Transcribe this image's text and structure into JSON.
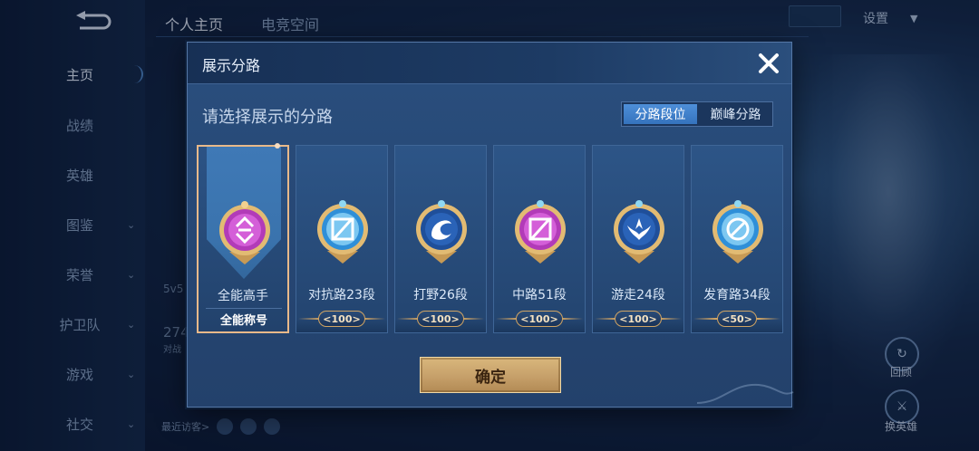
{
  "background": {
    "back_icon": "back-arrow-icon",
    "top_tabs": [
      "个人主页",
      "电竞空间"
    ],
    "settings_label": "设置",
    "sidebar_items": [
      {
        "label": "主页",
        "chevron": false,
        "active": true
      },
      {
        "label": "战绩",
        "chevron": false
      },
      {
        "label": "英雄",
        "chevron": false
      },
      {
        "label": "图鉴",
        "chevron": true
      },
      {
        "label": "荣誉",
        "chevron": true
      },
      {
        "label": "护卫队",
        "chevron": true
      },
      {
        "label": "游戏",
        "chevron": true
      },
      {
        "label": "社交",
        "chevron": true
      }
    ],
    "ghost_text": [
      "5v5",
      "274",
      "对战"
    ],
    "recent_visitors_label": "最近访客>",
    "right_button_1": "回顾",
    "right_button_2": "换英雄"
  },
  "dialog": {
    "title": "展示分路",
    "close_icon": "close-x-icon",
    "prompt": "请选择展示的分路",
    "toggle": {
      "options": [
        "分路段位",
        "巅峰分路"
      ],
      "selected": 0
    },
    "cards": [
      {
        "label": "全能高手",
        "sub": "全能称号",
        "badge": "omni-badge-icon",
        "selected": true,
        "color": "#b23bb8"
      },
      {
        "label": "对抗路23段",
        "score": "<100>",
        "badge": "clash-lane-badge-icon",
        "color": "#2f8fd8"
      },
      {
        "label": "打野26段",
        "score": "<100>",
        "badge": "jungle-badge-icon",
        "color": "#2a63b8"
      },
      {
        "label": "中路51段",
        "score": "<100>",
        "badge": "mid-lane-badge-icon",
        "color": "#b23bb8"
      },
      {
        "label": "游走24段",
        "score": "<100>",
        "badge": "roam-badge-icon",
        "color": "#2a63b8"
      },
      {
        "label": "发育路34段",
        "score": "<50>",
        "badge": "farm-lane-badge-icon",
        "color": "#2f8fd8"
      }
    ],
    "confirm_label": "确定"
  },
  "colors": {
    "gold": "#d0a463",
    "accent_blue": "#3f86d4",
    "panel": "#2a4f7e"
  }
}
